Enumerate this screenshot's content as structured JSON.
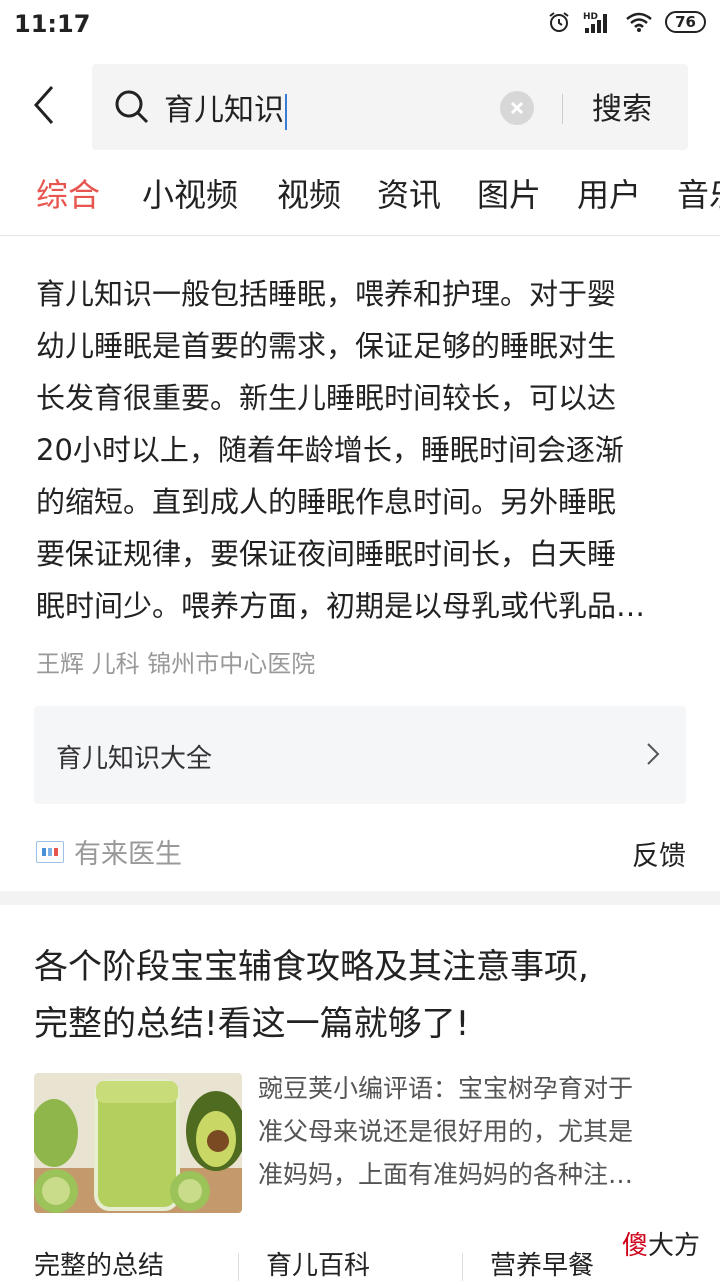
{
  "status_bar": {
    "time": "11:17",
    "network": "HD",
    "battery": "76"
  },
  "search": {
    "query": "育儿知识",
    "button_label": "搜索"
  },
  "tabs": [
    "综合",
    "小视频",
    "视频",
    "资讯",
    "图片",
    "用户",
    "音乐"
  ],
  "answer_card": {
    "lines": [
      "育儿知识一般包括睡眠，喂养和护理。对于婴",
      "幼儿睡眠是首要的需求，保证足够的睡眠对生",
      "长发育很重要。新生儿睡眠时间较长，可以达",
      "20小时以上，随着年龄增长，睡眠时间会逐渐",
      "的缩短。直到成人的睡眠作息时间。另外睡眠",
      "要保证规律，要保证夜间睡眠时间长，白天睡",
      "眠时间少。喂养方面，初期是以母乳或代乳品…"
    ],
    "source": "王辉 儿科 锦州市中心医院",
    "link_label": "育儿知识大全",
    "provider_name": "有来医生",
    "feedback_label": "反馈"
  },
  "article": {
    "title_line1": "各个阶段宝宝辅食攻略及其注意事项,",
    "title_line2": "完整的总结!看这一篇就够了!",
    "snippet_lines": [
      "豌豆荚小编评语：宝宝树孕育对于",
      "准父母来说还是很好用的，尤其是",
      "准妈妈，上面有准妈妈的各种注…"
    ],
    "tags": [
      "完整的总结",
      "育儿百科",
      "营养早餐"
    ]
  },
  "watermark": {
    "red_char": "傻",
    "rest": "大方"
  },
  "colors": {
    "accent": "#e8554e",
    "text": "#222222",
    "muted": "#999999"
  }
}
